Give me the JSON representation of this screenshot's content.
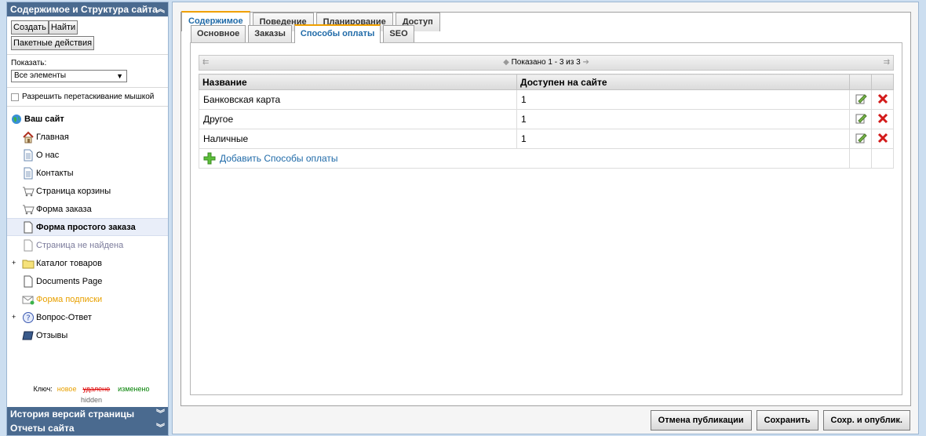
{
  "sidebar": {
    "title": "Содержимое и Структура сайта",
    "buttons": {
      "create": "Создать",
      "find": "Найти",
      "batch": "Пакетные действия"
    },
    "show_label": "Показать:",
    "show_value": "Все элементы",
    "drag_label": "Разрешить перетаскивание мышкой",
    "tree": {
      "root": "Ваш сайт",
      "items": [
        {
          "label": "Главная",
          "icon": "home-icon"
        },
        {
          "label": "О нас",
          "icon": "page-icon"
        },
        {
          "label": "Контакты",
          "icon": "page-icon"
        },
        {
          "label": "Страница корзины",
          "icon": "cart-icon"
        },
        {
          "label": "Форма заказа",
          "icon": "cart-icon"
        },
        {
          "label": "Форма простого заказа",
          "icon": "page-icon"
        },
        {
          "label": "Страница не найдена",
          "icon": "page-icon"
        },
        {
          "label": "Каталог товаров",
          "icon": "folder-icon"
        },
        {
          "label": "Documents Page",
          "icon": "page-icon"
        },
        {
          "label": "Форма подписки",
          "icon": "mail-icon"
        },
        {
          "label": "Вопрос-Ответ",
          "icon": "help-icon"
        },
        {
          "label": "Отзывы",
          "icon": "book-icon"
        }
      ]
    },
    "key": {
      "label": "Ключ:",
      "new": "новое",
      "deleted": "удалено",
      "changed": "изменено",
      "hidden": "hidden"
    },
    "history": "История версий страницы",
    "reports": "Отчеты сайта"
  },
  "tabs": {
    "main": [
      "Содержимое",
      "Поведение",
      "Планирование",
      "Доступ"
    ],
    "sub": [
      "Основное",
      "Заказы",
      "Способы оплаты",
      "SEO"
    ]
  },
  "grid": {
    "pager": "Показано 1 - 3 из 3",
    "columns": [
      "Название",
      "Доступен на сайте"
    ],
    "rows": [
      {
        "name": "Банковская карта",
        "available": "1"
      },
      {
        "name": "Другое",
        "available": "1"
      },
      {
        "name": "Наличные",
        "available": "1"
      }
    ],
    "add_label": "Добавить Способы оплаты"
  },
  "actions": {
    "unpublish": "Отмена публикации",
    "save": "Сохранить",
    "save_publish": "Сохр. и опублик."
  },
  "colors": {
    "accent": "#1f6aa8",
    "header": "#4a6a8f",
    "tab_highlight": "#f0a000"
  }
}
